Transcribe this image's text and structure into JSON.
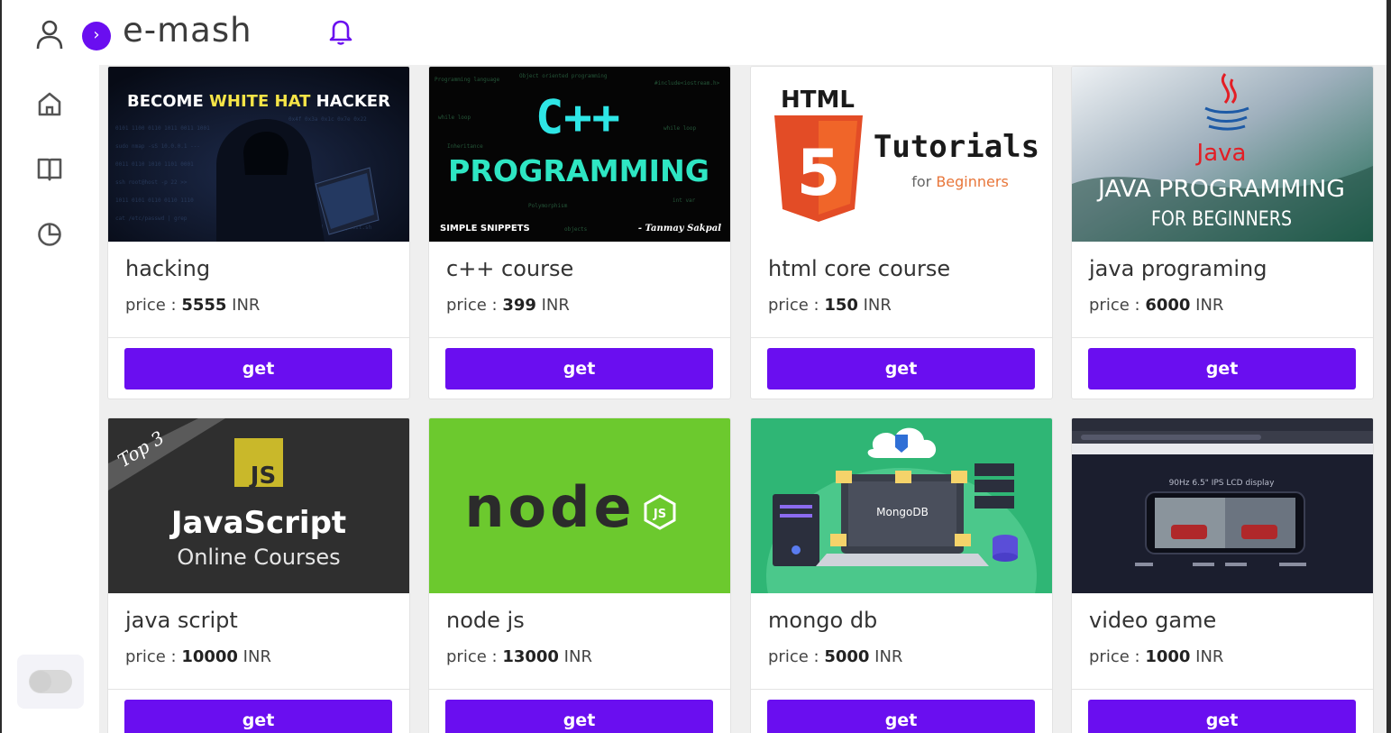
{
  "brand": {
    "name": "e-mash",
    "badge_glyph": "›"
  },
  "colors": {
    "accent": "#6a0ef0",
    "background": "#efefef"
  },
  "sidebar": {
    "items": [
      {
        "icon": "home-icon"
      },
      {
        "icon": "book-icon"
      },
      {
        "icon": "clock-icon"
      }
    ],
    "theme_toggle": "off"
  },
  "price_prefix": "price : ",
  "currency": "INR",
  "courses": [
    {
      "title": "hacking",
      "price": "5555",
      "button": "get",
      "thumb": {
        "line1a": "BECOME ",
        "line1b": "WHITE HAT",
        "line1c": " HACKER"
      }
    },
    {
      "title": "c++ course",
      "price": "399",
      "button": "get",
      "thumb": {
        "big": "C++",
        "sub": "PROGRAMMING",
        "brand": "SIMPLE SNIPPETS",
        "author": "- Tanmay Sakpal"
      }
    },
    {
      "title": "html core course",
      "price": "150",
      "button": "get",
      "thumb": {
        "top": "HTML",
        "shield": "5",
        "main": "Tutorials",
        "for": "for ",
        "for2": "Beginners"
      }
    },
    {
      "title": "java programing",
      "price": "6000",
      "button": "get",
      "thumb": {
        "logo": "Java",
        "line1": "JAVA PROGRAMMING",
        "line2": "FOR BEGINNERS"
      }
    },
    {
      "title": "java script",
      "price": "10000",
      "button": "get",
      "thumb": {
        "ribbon": "Top 3",
        "badge": "JS",
        "line1": "JavaScript",
        "line2": "Online Courses"
      }
    },
    {
      "title": "node js",
      "price": "13000",
      "button": "get",
      "thumb": {
        "word": "node",
        "badge": "JS"
      }
    },
    {
      "title": "mongo db",
      "price": "5000",
      "button": "get",
      "thumb": {
        "screen": "MongoDB"
      }
    },
    {
      "title": "video game",
      "price": "1000",
      "button": "get",
      "thumb": {
        "headline": "90Hz 6.5\" IPS LCD display"
      }
    }
  ]
}
